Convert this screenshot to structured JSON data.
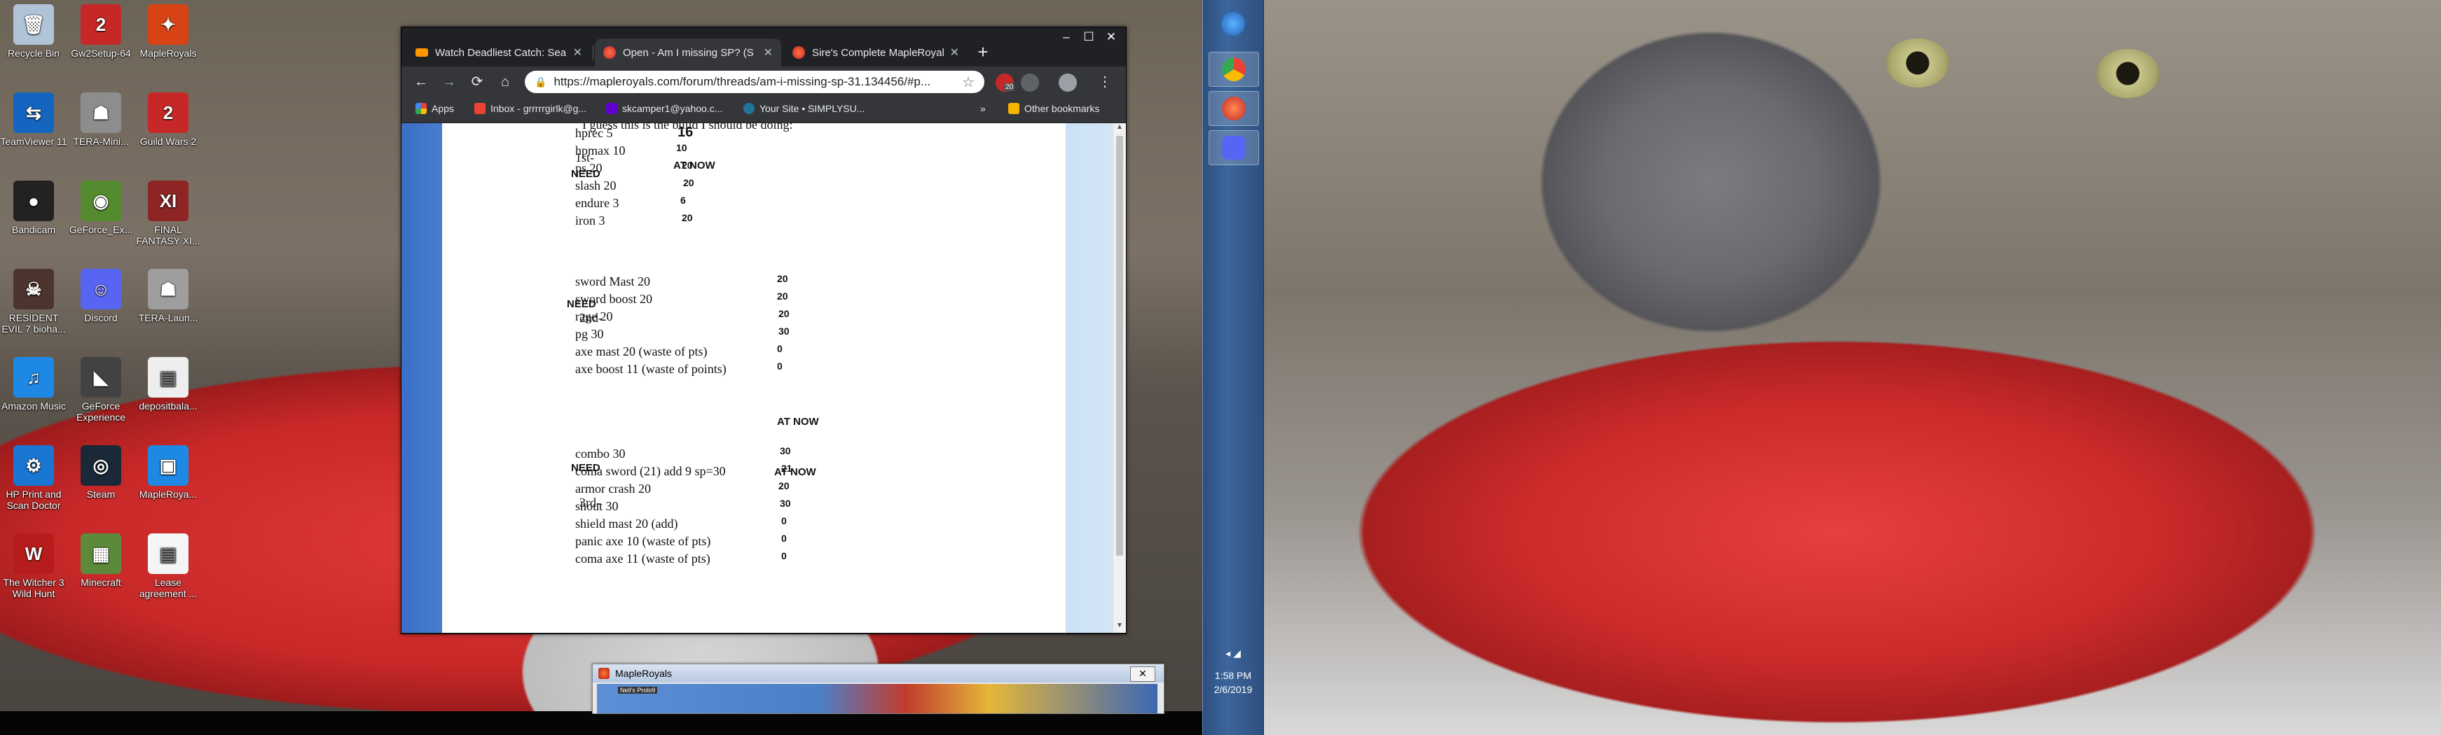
{
  "desktop_icons": [
    {
      "label": "Recycle Bin",
      "icon": "recycle-bin-icon",
      "color": "#b0c4d8",
      "glyph": "🗑"
    },
    {
      "label": "Gw2Setup-64",
      "icon": "gw2-setup-icon",
      "color": "#c62828",
      "glyph": "2"
    },
    {
      "label": "MapleRoyals",
      "icon": "mapleroyals-icon",
      "color": "#d84315",
      "glyph": "✦"
    },
    {
      "label": "TeamViewer 11",
      "icon": "teamviewer-icon",
      "color": "#1565c0",
      "glyph": "⇆"
    },
    {
      "label": "TERA-Mini...",
      "icon": "tera-mini-icon",
      "color": "#8d8d8d",
      "glyph": "☗"
    },
    {
      "label": "Guild Wars 2",
      "icon": "guild-wars-2-icon",
      "color": "#c62828",
      "glyph": "2"
    },
    {
      "label": "Bandicam",
      "icon": "bandicam-icon",
      "color": "#222222",
      "glyph": "●"
    },
    {
      "label": "GeForce_Ex...",
      "icon": "geforce-experience-installer-icon",
      "color": "#558b2f",
      "glyph": "◉"
    },
    {
      "label": "FINAL FANTASY XI...",
      "icon": "final-fantasy-xi-icon",
      "color": "#8e2424",
      "glyph": "XI"
    },
    {
      "label": "RESIDENT EVIL 7 bioha...",
      "icon": "resident-evil-7-icon",
      "color": "#4e342e",
      "glyph": "☠"
    },
    {
      "label": "Discord",
      "icon": "discord-icon",
      "color": "#5865f2",
      "glyph": "☺"
    },
    {
      "label": "TERA-Laun...",
      "icon": "tera-launcher-icon",
      "color": "#9e9e9e",
      "glyph": "☗"
    },
    {
      "label": "Amazon Music",
      "icon": "amazon-music-icon",
      "color": "#1e88e5",
      "glyph": "♫"
    },
    {
      "label": "GeForce Experience",
      "icon": "geforce-experience-icon",
      "color": "#424242",
      "glyph": "◣"
    },
    {
      "label": "depositbala...",
      "icon": "deposit-document-icon",
      "color": "#eeeeee",
      "glyph": "▤"
    },
    {
      "label": "HP Print and Scan Doctor",
      "icon": "hp-print-scan-icon",
      "color": "#1976d2",
      "glyph": "⚙"
    },
    {
      "label": "Steam",
      "icon": "steam-icon",
      "color": "#1b2838",
      "glyph": "◎"
    },
    {
      "label": "MapleRoya...",
      "icon": "mapleroyals-setup-icon",
      "color": "#1e88e5",
      "glyph": "▣"
    },
    {
      "label": "The Witcher 3 Wild Hunt",
      "icon": "witcher-3-icon",
      "color": "#b71c1c",
      "glyph": "W"
    },
    {
      "label": "Minecraft",
      "icon": "minecraft-icon",
      "color": "#5d8a3a",
      "glyph": "▦"
    },
    {
      "label": "Lease agreement ...",
      "icon": "lease-document-icon",
      "color": "#f5f5f5",
      "glyph": "▤"
    }
  ],
  "browser": {
    "tabs": [
      {
        "title": "Watch Deadliest Catch: Sea",
        "favicon": "discovery-favicon",
        "color": "#ff9800",
        "active": false
      },
      {
        "title": "Open - Am I missing SP? (S",
        "favicon": "mapleroyals-favicon",
        "color": "#e53935",
        "active": true
      },
      {
        "title": "Sire's Complete MapleRoyal",
        "favicon": "mapleroyals-favicon",
        "color": "#e53935",
        "active": false
      }
    ],
    "new_tab": "+",
    "window_buttons": {
      "minimize": "–",
      "maximize": "☐",
      "close": "✕"
    },
    "nav": {
      "back": "←",
      "forward": "→",
      "reload": "⟳",
      "home": "⌂"
    },
    "url": "https://mapleroyals.com/forum/threads/am-i-missing-sp-31.134456/#p...",
    "star": "☆",
    "extension_badge": "20",
    "menu": "⋮",
    "bookmarks": [
      {
        "label": "Apps",
        "icon": "apps-grid-icon",
        "color": "#f4b400"
      },
      {
        "label": "Inbox - grrrrrgirlk@g...",
        "icon": "gmail-icon",
        "color": "#ea4335"
      },
      {
        "label": "skcamper1@yahoo.c...",
        "icon": "yahoo-mail-icon",
        "color": "#6001d2"
      },
      {
        "label": "Your Site • SIMPLYSU...",
        "icon": "wordpress-icon",
        "color": "#21759b"
      }
    ],
    "bookmarks_overflow": "»",
    "other_bookmarks": "Other bookmarks"
  },
  "post": {
    "intro": "I guess this is the build I should be doing:",
    "sections": [
      {
        "title": "1st-",
        "need": "NEED",
        "at_now": "AT NOW",
        "rows": [
          {
            "skill": "hprec 5",
            "now": "16"
          },
          {
            "skill": "hpmax 10",
            "now": "10"
          },
          {
            "skill": "ps 20",
            "now": "20"
          },
          {
            "skill": "slash 20",
            "now": "20"
          },
          {
            "skill": "endure 3",
            "now": "6"
          },
          {
            "skill": "iron 3",
            "now": "20"
          }
        ]
      },
      {
        "title": "2nd-",
        "need": "NEED",
        "at_now": "AT NOW",
        "rows": [
          {
            "skill": "sword Mast 20",
            "now": "20"
          },
          {
            "skill": "sword boost 20",
            "now": "20"
          },
          {
            "skill": "rage 20",
            "now": "20"
          },
          {
            "skill": "pg 30",
            "now": "30"
          },
          {
            "skill": "axe mast 20 (waste of pts)",
            "now": "0"
          },
          {
            "skill": "axe boost 11 (waste of points)",
            "now": "0"
          }
        ]
      },
      {
        "title": "3rd-",
        "need": "NEED",
        "at_now": "AT NOW",
        "rows": [
          {
            "skill": "combo 30",
            "now": "30"
          },
          {
            "skill": "coma sword (21) add 9 sp=30",
            "now": "21"
          },
          {
            "skill": "armor crash 20",
            "now": "20"
          },
          {
            "skill": "shout 30",
            "now": "30"
          },
          {
            "skill": "shield mast 20 (add)",
            "now": "0"
          },
          {
            "skill": "panic axe 10 (waste of pts)",
            "now": "0"
          },
          {
            "skill": "coma axe 11 (waste of pts)",
            "now": "0"
          }
        ]
      }
    ]
  },
  "maple_window": {
    "title": "MapleRoyals",
    "close": "✕",
    "mini_label": "Nell's Prolo9"
  },
  "taskbar": {
    "items": [
      {
        "name": "windows-start-icon",
        "color": "#1e88e5"
      },
      {
        "name": "chrome-icon",
        "color": "#34a853"
      },
      {
        "name": "mapleroyals-taskbar-icon",
        "color": "#e64a19"
      },
      {
        "name": "discord-taskbar-icon",
        "color": "#5865f2"
      }
    ],
    "tray": "◂  ◢",
    "time": "1:58 PM",
    "date": "2/6/2019"
  }
}
